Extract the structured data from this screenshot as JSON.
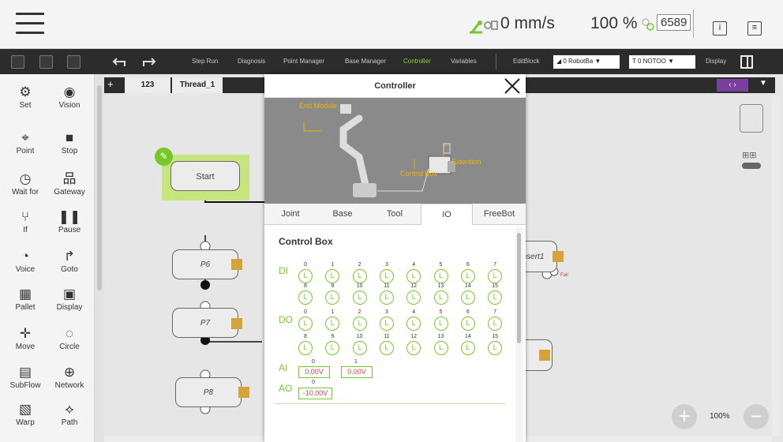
{
  "topbar": {
    "speed": "0 mm/s",
    "percent": "100 %",
    "counter": "6589"
  },
  "toolbar": {
    "items": [
      "Step Run",
      "Diagnosis",
      "Point Manager",
      "Base Manager",
      "Controller",
      "Variables"
    ],
    "editblock": "EditBlock",
    "base_select": "0 RobotBa",
    "tool_select": "0 NOTOO",
    "display": "Display"
  },
  "sidebar": [
    {
      "label": "Set",
      "icon": "set-icon"
    },
    {
      "label": "Vision",
      "icon": "vision-icon"
    },
    {
      "label": "Point",
      "icon": "point-icon"
    },
    {
      "label": "Stop",
      "icon": "stop-icon"
    },
    {
      "label": "Wait for",
      "icon": "wait-icon"
    },
    {
      "label": "Gateway",
      "icon": "gateway-icon"
    },
    {
      "label": "If",
      "icon": "if-icon"
    },
    {
      "label": "Pause",
      "icon": "pause-icon"
    },
    {
      "label": "Voice",
      "icon": "voice-icon"
    },
    {
      "label": "Goto",
      "icon": "goto-icon"
    },
    {
      "label": "Pallet",
      "icon": "pallet-icon"
    },
    {
      "label": "Display",
      "icon": "display-icon"
    },
    {
      "label": "Move",
      "icon": "move-icon"
    },
    {
      "label": "Circle",
      "icon": "circle-icon"
    },
    {
      "label": "SubFlow",
      "icon": "subflow-icon"
    },
    {
      "label": "Network",
      "icon": "network-icon"
    },
    {
      "label": "Warp",
      "icon": "warp-icon"
    },
    {
      "label": "Path",
      "icon": "path-icon"
    }
  ],
  "canvas": {
    "tabs": [
      "123",
      "Thread_1"
    ],
    "nodes": {
      "start": "Start",
      "p6": "P6",
      "p7": "P7",
      "p8": "P8",
      "insert": "nsert1",
      "fail": "Fail"
    },
    "zoom": "100%"
  },
  "modal": {
    "title": "Controller",
    "robot_labels": {
      "end_module": "End Module",
      "control_box": "Control Box",
      "extention": "Extention"
    },
    "tabs": [
      "Joint",
      "Base",
      "Tool",
      "IO",
      "FreeBot"
    ],
    "active_tab": "IO",
    "section_title": "Control Box",
    "di_label": "DI",
    "do_label": "DO",
    "ai_label": "AI",
    "ao_label": "AO",
    "channel_numbers": [
      "0",
      "1",
      "2",
      "3",
      "4",
      "5",
      "6",
      "7",
      "8",
      "9",
      "10",
      "11",
      "12",
      "13",
      "14",
      "15"
    ],
    "state_letter": "L",
    "ai_channels": [
      "0",
      "1"
    ],
    "ai_values": [
      "0.00V",
      "0.00V"
    ],
    "ao_channels": [
      "0"
    ],
    "ao_values": [
      "-10.00V"
    ]
  }
}
